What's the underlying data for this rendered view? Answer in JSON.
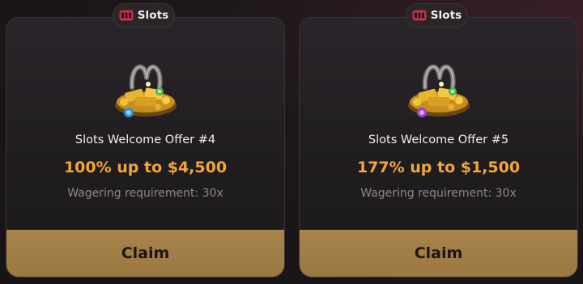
{
  "cards": [
    {
      "tag": "Slots",
      "tag_icon": "slot-machine-icon",
      "prize_icon": "horseshoe-gold-pile-icon",
      "title": "Slots Welcome Offer #4",
      "offer": "100% up to $4,500",
      "wagering": "Wagering requirement: 30x",
      "button": "Claim"
    },
    {
      "tag": "Slots",
      "tag_icon": "slot-machine-icon",
      "prize_icon": "horseshoe-gold-pile-icon",
      "title": "Slots Welcome Offer #5",
      "offer": "177% up to $1,500",
      "wagering": "Wagering requirement: 30x",
      "button": "Claim"
    }
  ],
  "colors": {
    "offer_accent": "#f0a63a",
    "claim_button": "#a7844a",
    "card_background": "#242024",
    "page_background": "#1a1618"
  }
}
